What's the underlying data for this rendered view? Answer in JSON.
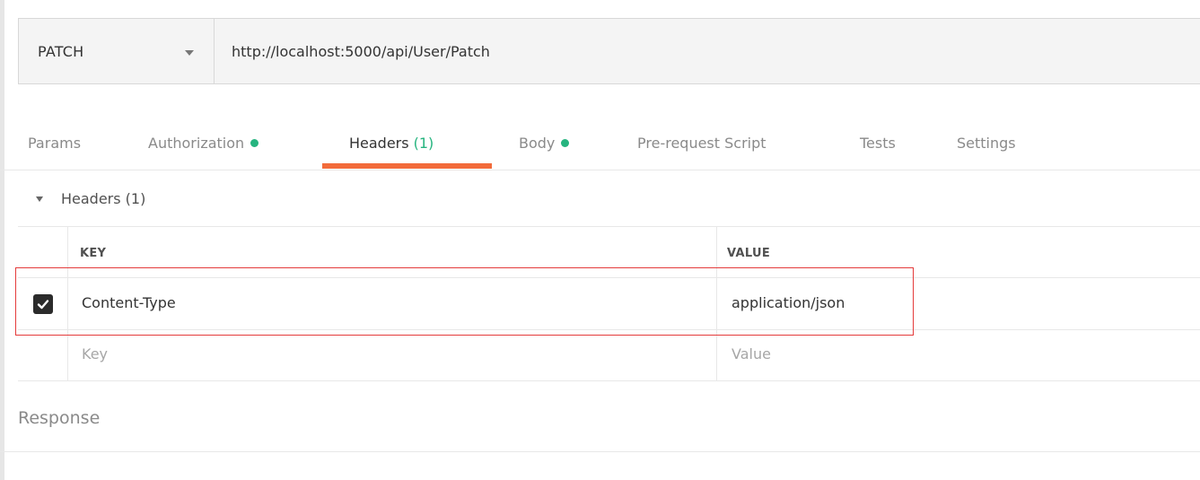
{
  "request": {
    "method": "PATCH",
    "url": "http://localhost:5000/api/User/Patch"
  },
  "tabs": [
    {
      "label": "Params"
    },
    {
      "label": "Authorization",
      "dot": true
    },
    {
      "label": "Headers",
      "count": "(1)",
      "active": true
    },
    {
      "label": "Body",
      "dot": true
    },
    {
      "label": "Pre-request Script"
    },
    {
      "label": "Tests"
    },
    {
      "label": "Settings"
    }
  ],
  "headers_section": {
    "title": "Headers (1)",
    "columns": {
      "key": "KEY",
      "value": "VALUE"
    },
    "rows": [
      {
        "checked": true,
        "key": "Content-Type",
        "value": "application/json"
      }
    ],
    "new_row": {
      "key_placeholder": "Key",
      "value_placeholder": "Value"
    }
  },
  "response": {
    "label": "Response"
  },
  "colors": {
    "accent_tab": "#f26b3a",
    "status_dot": "#26b47f",
    "highlight": "#e43b3b"
  }
}
